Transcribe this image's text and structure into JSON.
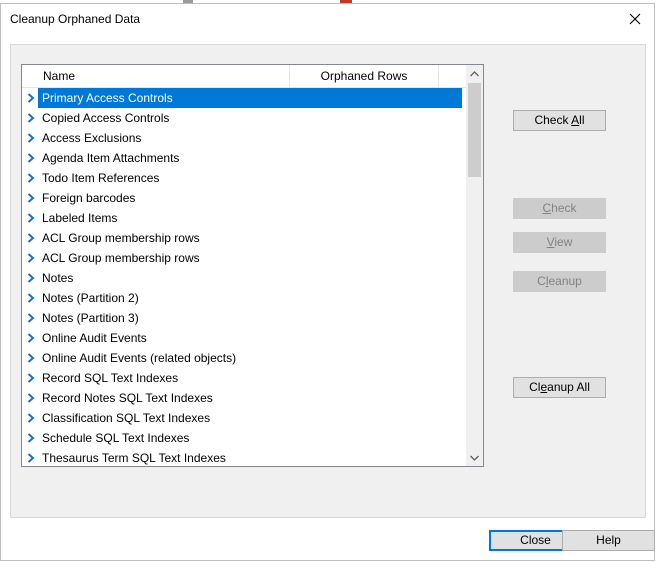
{
  "dialog": {
    "title": "Cleanup Orphaned Data"
  },
  "list": {
    "columns": {
      "name": "Name",
      "orphaned_rows": "Orphaned Rows"
    },
    "items": [
      {
        "label": "Primary Access Controls",
        "selected": true
      },
      {
        "label": "Copied Access Controls"
      },
      {
        "label": "Access Exclusions"
      },
      {
        "label": "Agenda Item Attachments"
      },
      {
        "label": "Todo Item References"
      },
      {
        "label": "Foreign barcodes"
      },
      {
        "label": "Labeled Items"
      },
      {
        "label": "ACL Group membership rows"
      },
      {
        "label": "ACL Group membership rows"
      },
      {
        "label": "Notes"
      },
      {
        "label": "Notes (Partition 2)"
      },
      {
        "label": "Notes (Partition 3)"
      },
      {
        "label": "Online Audit Events"
      },
      {
        "label": "Online Audit Events (related objects)"
      },
      {
        "label": "Record SQL Text Indexes"
      },
      {
        "label": "Record Notes SQL Text Indexes"
      },
      {
        "label": "Classification SQL Text Indexes"
      },
      {
        "label": "Schedule SQL Text Indexes"
      },
      {
        "label": "Thesaurus Term SQL Text Indexes"
      }
    ]
  },
  "buttons": {
    "check_all": {
      "pre": "Check ",
      "key": "A",
      "post": "ll"
    },
    "check": {
      "pre": "",
      "key": "C",
      "post": "heck"
    },
    "view": {
      "pre": "",
      "key": "V",
      "post": "iew"
    },
    "cleanup": {
      "pre": "C",
      "key": "l",
      "post": "eanup"
    },
    "cleanup_all": {
      "pre": "Cl",
      "key": "e",
      "post": "anup All"
    },
    "close": "Close",
    "help": "Help"
  },
  "colors": {
    "selection": "#0078d7",
    "chevron": "#1a6fc9"
  },
  "icons": {
    "row_expander": "chevron-right-icon",
    "close": "close-icon",
    "scroll_up": "chevron-up-icon",
    "scroll_down": "chevron-down-icon"
  }
}
